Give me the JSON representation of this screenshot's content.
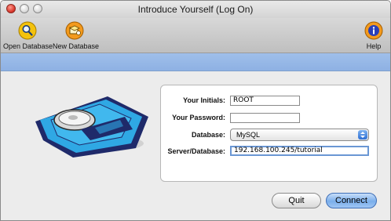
{
  "window": {
    "title": "Introduce Yourself (Log On)"
  },
  "toolbar": {
    "open_label": "Open Database",
    "new_label": "New Database",
    "help_label": "Help",
    "icons": {
      "open": "magnifier-icon",
      "new": "new-database-icon",
      "help": "info-icon"
    }
  },
  "form": {
    "initials_label": "Your Initials:",
    "initials_value": "ROOT",
    "password_label": "Your Password:",
    "password_value": "",
    "database_label": "Database:",
    "database_selected": "MySQL",
    "server_label": "Server/Database:",
    "server_value": "192.168.100.245/tutorial"
  },
  "buttons": {
    "quit": "Quit",
    "connect": "Connect"
  },
  "colors": {
    "accent": "#8eb1e3",
    "default_button": "#7aaeeb",
    "close": "#d9352a"
  }
}
